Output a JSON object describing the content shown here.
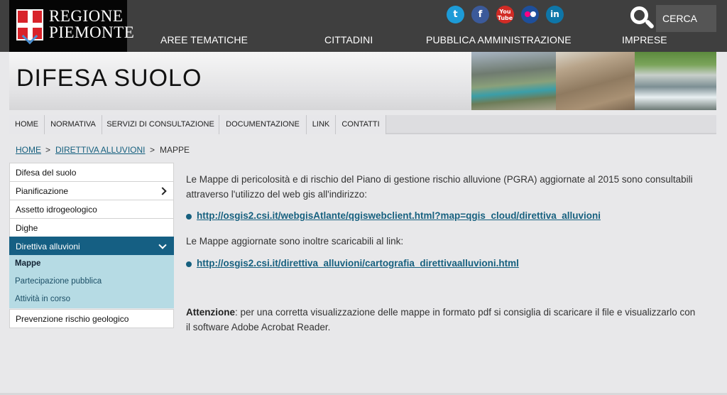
{
  "header": {
    "logo_line1": "REGIONE",
    "logo_line2": "PIEMONTE",
    "social": [
      {
        "name": "twitter",
        "glyph": "t",
        "color": "#1d9bd7"
      },
      {
        "name": "facebook",
        "glyph": "f",
        "color": "#3b5a9a"
      },
      {
        "name": "youtube",
        "glyph": "You\nTube",
        "color": "#d12b25"
      },
      {
        "name": "flickr",
        "glyph": "",
        "color": "#1e4f9b"
      },
      {
        "name": "linkedin",
        "glyph": "in",
        "color": "#0e76a8"
      }
    ],
    "search_label": "CERCA",
    "nav": [
      "AREE TEMATICHE",
      "CITTADINI",
      "PUBBLICA AMMINISTRAZIONE",
      "IMPRESE"
    ]
  },
  "banner": {
    "title": "DIFESA SUOLO"
  },
  "subnav": [
    "HOME",
    "NORMATIVA",
    "SERVIZI DI CONSULTAZIONE",
    "DOCUMENTAZIONE",
    "LINK",
    "CONTATTI"
  ],
  "breadcrumb": {
    "home": "HOME",
    "parent": "DIRETTIVA ALLUVIONI",
    "current": "MAPPE",
    "separator": ">"
  },
  "sidebar": {
    "items": [
      {
        "label": "Difesa del suolo"
      },
      {
        "label": "Pianificazione"
      },
      {
        "label": "Assetto idrogeologico"
      },
      {
        "label": "Dighe"
      },
      {
        "label": "Direttiva alluvioni"
      }
    ],
    "subitems": [
      {
        "label": "Mappe"
      },
      {
        "label": "Partecipazione pubblica"
      },
      {
        "label": "Attività in corso"
      }
    ],
    "last": {
      "label": "Prevenzione rischio geologico"
    }
  },
  "content": {
    "intro": "Le Mappe di pericolosità e di rischio del Piano di gestione rischio alluvione (PGRA) aggiornate al 2015 sono consultabili attraverso l'utilizzo del web gis all'indirizzo:",
    "link1": "http://osgis2.csi.it/webgisAtlante/qgiswebclient.html?map=qgis_cloud/direttiva_alluvioni",
    "intro2": "Le Mappe aggiornate sono inoltre scaricabili al link:",
    "link2": "http://osgis2.csi.it/direttiva_alluvioni/cartografia_direttivaalluvioni.html",
    "attention_label": "Attenzione",
    "attention_text": ": per una corretta visualizzazione delle mappe in formato pdf si consiglia di scaricare il file e visualizzarlo con il software Adobe Acrobat Reader."
  },
  "colors": {
    "header_bg": "#3f3f3f",
    "accent": "#155f83",
    "sub_bg": "#b6dbe4",
    "page_bg": "#e8e8ea"
  }
}
